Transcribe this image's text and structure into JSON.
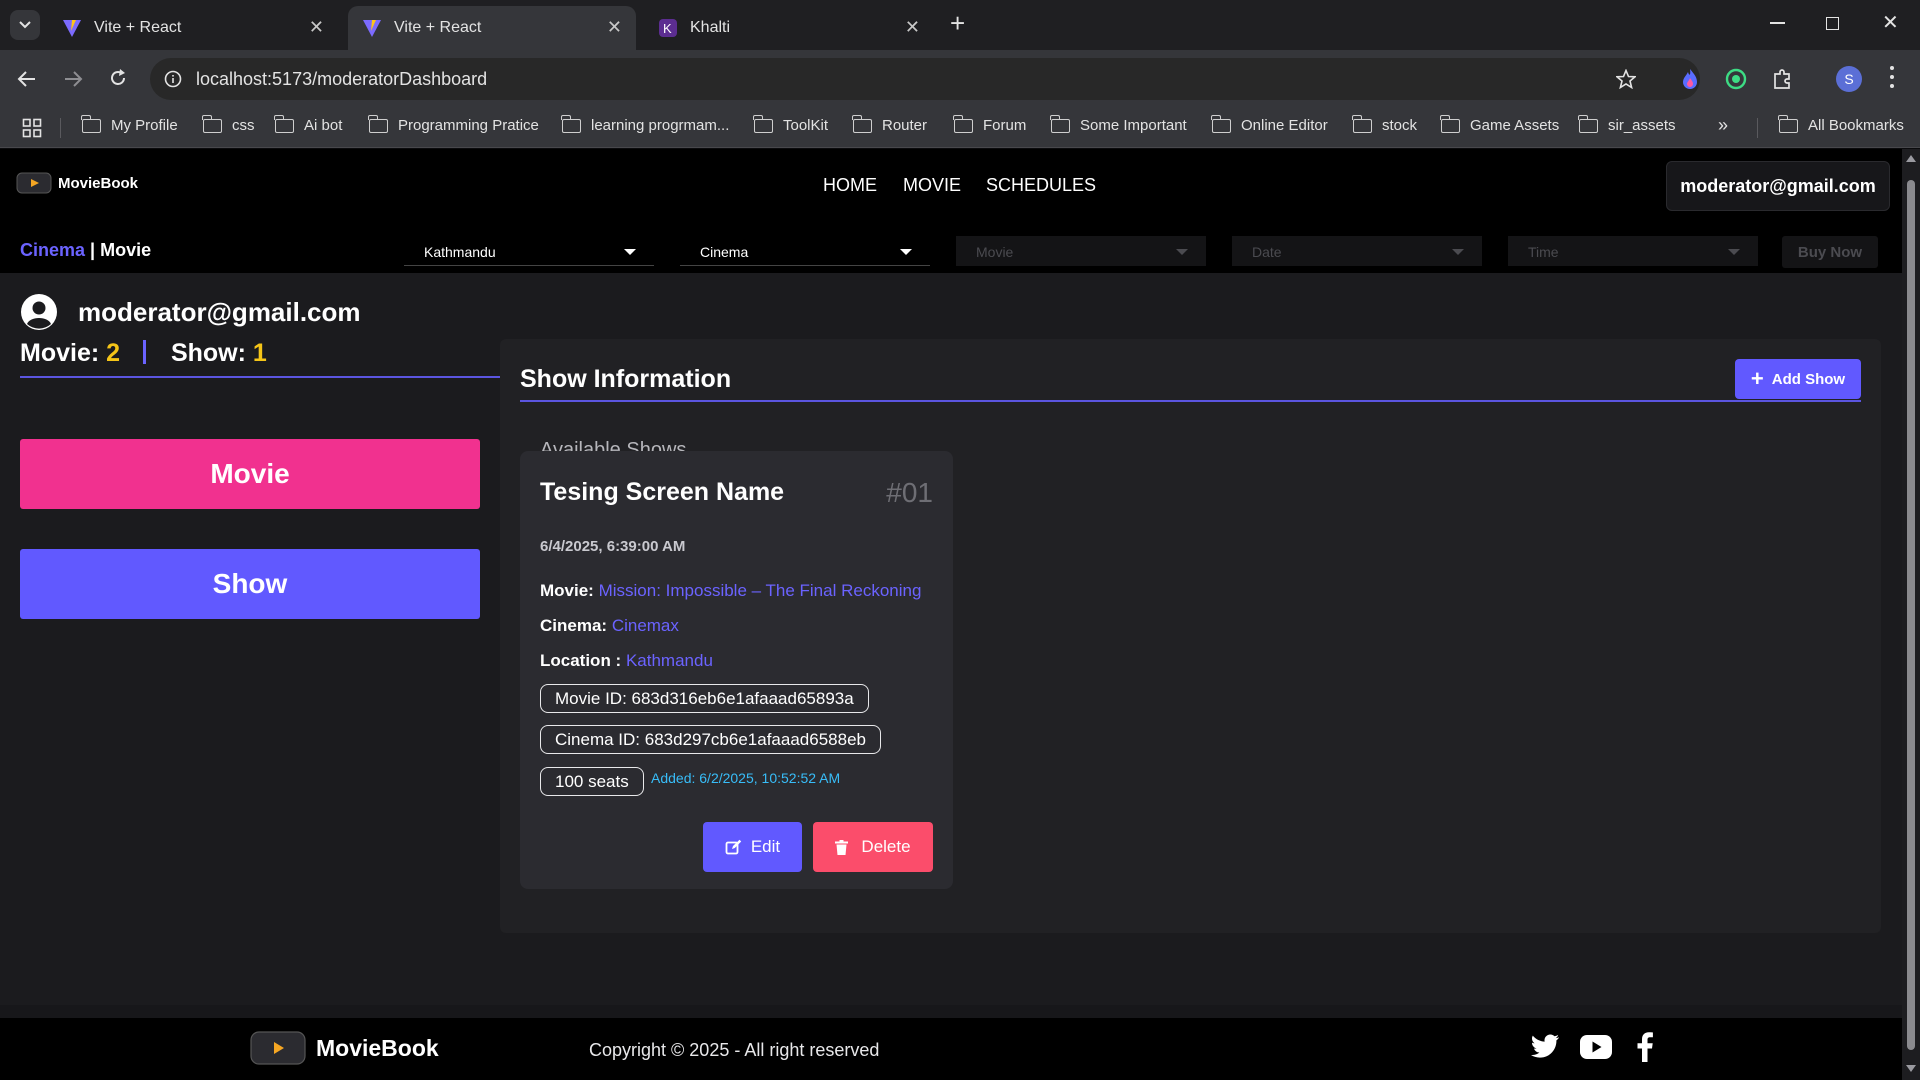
{
  "browser": {
    "tabs": [
      {
        "title": "Vite + React",
        "active": false
      },
      {
        "title": "Vite + React",
        "active": true
      },
      {
        "title": "Khalti",
        "active": false
      }
    ],
    "url": "localhost:5173/moderatorDashboard",
    "profile_initial": "S",
    "bookmarks": [
      "My Profile",
      "css",
      "Ai bot",
      "Programming Pratice",
      "learning progrmam...",
      "ToolKit",
      "Router",
      "Forum",
      "Some Important",
      "Online Editor",
      "stock",
      "Game Assets",
      "sir_assets"
    ],
    "all_bookmarks": "All Bookmarks"
  },
  "navbar": {
    "brand": "MovieBook",
    "links": [
      "HOME",
      "MOVIE",
      "SCHEDULES"
    ],
    "user": "moderator@gmail.com",
    "crumb_cinema": "Cinema",
    "crumb_sep": "|",
    "crumb_movie": "Movie",
    "filters": {
      "location": "Kathmandu",
      "cinema": "Cinema",
      "movie": "Movie",
      "date": "Date",
      "time": "Time"
    },
    "buy_now": "Buy Now"
  },
  "dashboard": {
    "email": "moderator@gmail.com",
    "movie_label": "Movie:",
    "movie_count": "2",
    "show_label": "Show:",
    "show_count": "1",
    "sidebar": {
      "movie_button": "Movie",
      "show_button": "Show"
    },
    "section_title": "Show Information",
    "add_show": "Add Show",
    "available_shows": "Available Shows",
    "show_card": {
      "screen_name": "Tesing Screen Name",
      "number": "#01",
      "datetime": "6/4/2025, 6:39:00 AM",
      "movie_label": "Movie:",
      "movie": "Mission: Impossible – The Final Reckoning",
      "cinema_label": "Cinema:",
      "cinema": "Cinemax",
      "location_label": "Location :",
      "location": "Kathmandu",
      "movie_id": "Movie ID: 683d316eb6e1afaaad65893a",
      "cinema_id": "Cinema ID: 683d297cb6e1afaaad6588eb",
      "seats": "100 seats",
      "added": "Added: 6/2/2025, 10:52:52 AM",
      "edit": "Edit",
      "delete": "Delete"
    }
  },
  "footer": {
    "brand": "MovieBook",
    "copyright": "Copyright © 2025 - All right reserved",
    "social": [
      "twitter-icon",
      "youtube-icon",
      "facebook-icon"
    ]
  },
  "colors": {
    "accent": "#6b63ff",
    "pink": "#f1318f",
    "delete": "#fb4d6b",
    "yellow": "#f5c518",
    "added": "#38bdf8"
  }
}
